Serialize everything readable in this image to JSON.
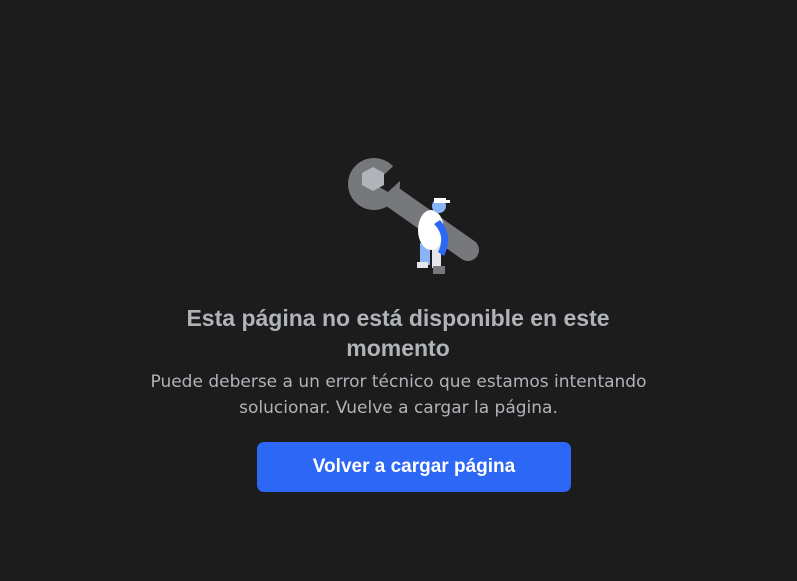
{
  "error": {
    "title": "Esta página no está disponible en este momento",
    "description": "Puede deberse a un error técnico que estamos intentando solucionar. Vuelve a cargar la página.",
    "illustration": "wrench-worker-icon"
  },
  "actions": {
    "reload_label": "Volver a cargar página"
  },
  "colors": {
    "background": "#1c1c1d",
    "text": "#b0b3b8",
    "accent": "#2d67f5",
    "button_text": "#ffffff"
  }
}
